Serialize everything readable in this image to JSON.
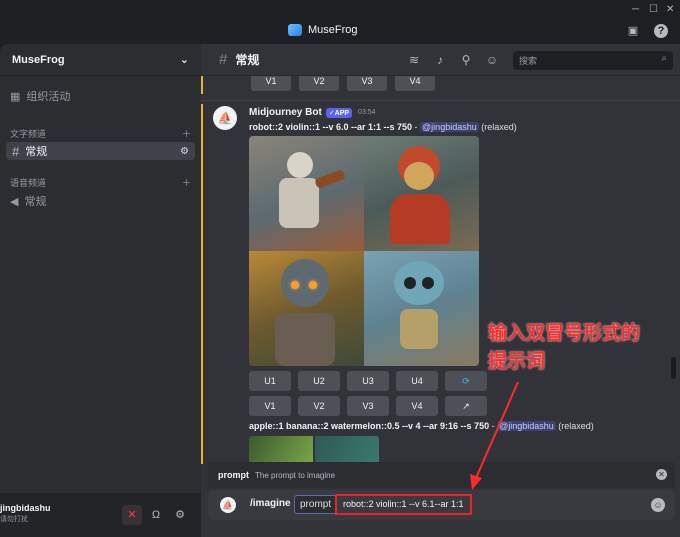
{
  "window": {
    "app_name": "MuseFrog"
  },
  "sidebar": {
    "server_name": "MuseFrog",
    "events_label": "组织活动",
    "text_category": "文字频道",
    "text_channel": "常规",
    "voice_category": "语音频道",
    "voice_channel": "常规"
  },
  "user_panel": {
    "username": "jingbidashu",
    "status": "请勿打扰"
  },
  "channel_header": {
    "name": "常规",
    "search_placeholder": "搜索"
  },
  "prev_message": {
    "buttons": [
      "V1",
      "V2",
      "V3",
      "V4"
    ]
  },
  "message": {
    "author": "Midjourney Bot",
    "badge": "✓APP",
    "time": "03:54",
    "prompt": "robot::2 violin::1 --v 6.0 --ar 1:1 --s 750",
    "separator": " - ",
    "mention": "@jingbidashu",
    "mode": "(relaxed)",
    "upscale_buttons": [
      "U1",
      "U2",
      "U3",
      "U4"
    ],
    "variation_buttons": [
      "V1",
      "V2",
      "V3",
      "V4"
    ]
  },
  "next_message": {
    "prompt": "apple::1 banana::2 watermelon::0.5 --v 4 --ar 9:16 --s 750",
    "separator": " - ",
    "mention": "@jingbidashu",
    "mode": "(relaxed)"
  },
  "annotation": {
    "line1": "输入双冒号形式的",
    "line2": "提示词",
    "color": "#ff2a2a"
  },
  "command_popup": {
    "option": "prompt",
    "description": "The prompt to imagine"
  },
  "input": {
    "command": "/imagine",
    "option": "prompt",
    "value": "robot::2 violin::1 --v 6.1--ar 1:1"
  }
}
